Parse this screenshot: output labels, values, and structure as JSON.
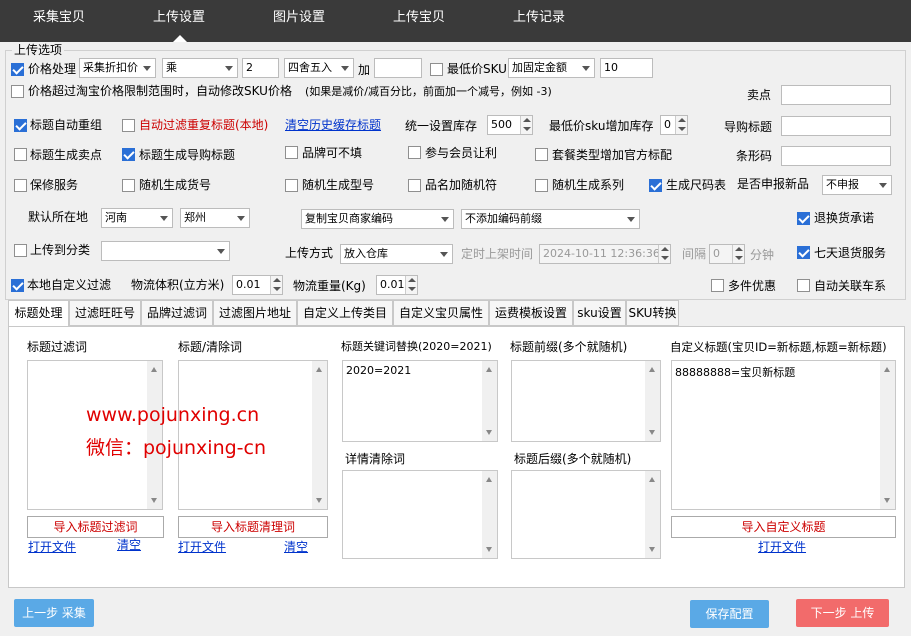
{
  "nav": {
    "tabs": [
      "采集宝贝",
      "上传设置",
      "图片设置",
      "上传宝贝",
      "上传记录"
    ]
  },
  "section_title": "上传选项",
  "row1": {
    "price_process": "价格处理",
    "price_mode": "采集折扣价",
    "op": "乘",
    "factor": "2",
    "rounding": "四舍五入",
    "add_label": "加",
    "add_value": "",
    "min_sku": "最低价SKU",
    "min_sku_mode": "加固定金额",
    "min_sku_value": "10"
  },
  "row2": {
    "auto_modify": "价格超过淘宝价格限制范围时，自动修改SKU价格",
    "hint": "(如果是减价/减百分比，前面加一个减号，例如 -3)",
    "selling_point": "卖点",
    "selling_point_value": ""
  },
  "row3": {
    "title_regroup": "标题自动重组",
    "auto_filter": "自动过滤重复标题(本地)",
    "clear_cache": "清空历史缓存标题",
    "stock_label": "统一设置库存",
    "stock_value": "500",
    "min_sku_stock": "最低价sku增加库存",
    "min_sku_stock_value": "0",
    "guide_title": "导购标题",
    "guide_title_value": ""
  },
  "row4": {
    "title_gen_selling": "标题生成卖点",
    "title_gen_guide": "标题生成导购标题",
    "brand_empty": "品牌可不填",
    "member_discount": "参与会员让利",
    "combo_official": "套餐类型增加官方标配",
    "barcode": "条形码",
    "barcode_value": ""
  },
  "row5": {
    "warranty": "保修服务",
    "rand_sku": "随机生成货号",
    "rand_model": "随机生成型号",
    "name_rand": "品名加随机符",
    "rand_series": "随机生成系列",
    "size_table": "生成尺码表",
    "new_product": "是否申报新品",
    "new_product_value": "不申报"
  },
  "row6": {
    "location_label": "默认所在地",
    "province": "河南",
    "city": "郑州",
    "copy_code": "复制宝贝商家编码",
    "code_prefix": "不添加编码前缀",
    "return_promise": "退换货承诺"
  },
  "row7": {
    "upload_category": "上传到分类",
    "category_value": "",
    "upload_method_label": "上传方式",
    "upload_method": "放入仓库",
    "timed_label": "定时上架时间",
    "timed_value": "2024-10-11 12:36:36",
    "interval_label": "间隔",
    "interval_value": "0",
    "minute_label": "分钟",
    "seven_day": "七天退货服务"
  },
  "row8": {
    "local_filter": "本地自定义过滤",
    "volume_label": "物流体积(立方米)",
    "volume_value": "0.01",
    "weight_label": "物流重量(Kg)",
    "weight_value": "0.01",
    "multi_discount": "多件优惠",
    "auto_link": "自动关联车系"
  },
  "tabs2": [
    "标题处理",
    "过滤旺旺号",
    "品牌过滤词",
    "过滤图片地址",
    "自定义上传类目",
    "自定义宝贝属性",
    "运费模板设置",
    "sku设置",
    "SKU转换"
  ],
  "panel": {
    "col1_title": "标题过滤词",
    "col1_import": "导入标题过滤词",
    "col1_open": "打开文件",
    "col1_clear": "清空",
    "col2_title": "标题/清除词",
    "col2_import": "导入标题清理词",
    "col2_open": "打开文件",
    "col2_clear": "清空",
    "col3_title": "标题关键词替换(2020=2021)",
    "col3_value": "2020=2021",
    "col3b_title": "详情清除词",
    "col4_title": "标题前缀(多个就随机)",
    "col4b_title": "标题后缀(多个就随机)",
    "col5_title": "自定义标题(宝贝ID=新标题,标题=新标题)",
    "col5_value": "88888888=宝贝新标题",
    "col5_import": "导入自定义标题",
    "col5_open": "打开文件"
  },
  "watermark": {
    "line1": "www.pojunxing.cn",
    "line2": "微信：pojunxing-cn"
  },
  "footer": {
    "prev": "上一步 采集",
    "save": "保存配置",
    "next": "下一步 上传"
  },
  "colors": {
    "topbar": "#3a3a3a",
    "prev_btn": "#5aa9e6",
    "save_btn": "#5aa9e6",
    "next_btn": "#f26b6b",
    "link": "#0033cc",
    "alert": "#cc0000"
  }
}
